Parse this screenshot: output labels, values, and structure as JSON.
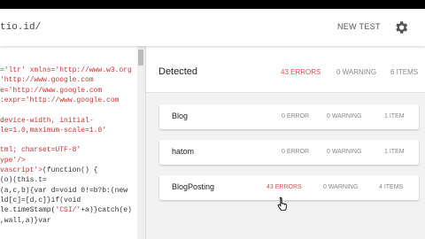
{
  "topbar": {
    "url": "tio.id/",
    "new_test": "NEW TEST"
  },
  "code": {
    "lines": [
      {
        "pre": "",
        "str": "='ltr' xmlns='http://www.w3.org",
        "post": ""
      },
      {
        "pre": "",
        "str": "'http://www.google.com",
        "post": ""
      },
      {
        "pre": "",
        "str": "e='http://www.google.com",
        "post": ""
      },
      {
        "pre": "",
        "str": ":expr='http://www.google.com",
        "post": ""
      },
      {
        "pre": "",
        "str": "",
        "post": ""
      },
      {
        "pre": "",
        "str": "device-width, initial-",
        "post": ""
      },
      {
        "pre": "",
        "str": "le=1.0,maximum-scale=1.0'",
        "post": ""
      },
      {
        "pre": "",
        "str": "",
        "post": ""
      },
      {
        "pre": "",
        "str": "tml; charset=UTF-8'",
        "post": ""
      },
      {
        "pre": "",
        "str": "ype'/>",
        "post": ""
      },
      {
        "pre": "",
        "str": "vascript'>",
        "post": "(function() {"
      },
      {
        "pre": "(o)(this.t=",
        "str": "",
        "post": ""
      },
      {
        "pre": "(a,c,b){var d=void 0!=b?b:(new",
        "str": "",
        "post": ""
      },
      {
        "pre": "ld[c]=[d,c]}if(void",
        "str": "",
        "post": ""
      },
      {
        "pre": "le.timeStamp(",
        "str": "'CSI/'",
        "post": "+a)}catch(e)"
      },
      {
        "pre": ",wall,a)}var",
        "str": "",
        "post": ""
      }
    ]
  },
  "summary": {
    "title": "Detected",
    "errors": "43 ERRORS",
    "warnings": "0 WARNING",
    "items": "6 ITEMS"
  },
  "cards": [
    {
      "name": "Blog",
      "errors": "0 ERROR",
      "warnings": "0 WARNING",
      "items": "1 ITEM",
      "error_highlight": false
    },
    {
      "name": "hatom",
      "errors": "0 ERROR",
      "warnings": "0 WARNING",
      "items": "1 ITEM",
      "error_highlight": false
    },
    {
      "name": "BlogPosting",
      "errors": "43 ERRORS",
      "warnings": "0 WARNING",
      "items": "4 ITEMS",
      "error_highlight": true
    }
  ],
  "colors": {
    "error": "#d9534f",
    "muted": "#888888",
    "panel_bg": "#f2f2f2"
  },
  "icons": {
    "settings": "gear-icon",
    "pointer": "hand-cursor-icon"
  }
}
